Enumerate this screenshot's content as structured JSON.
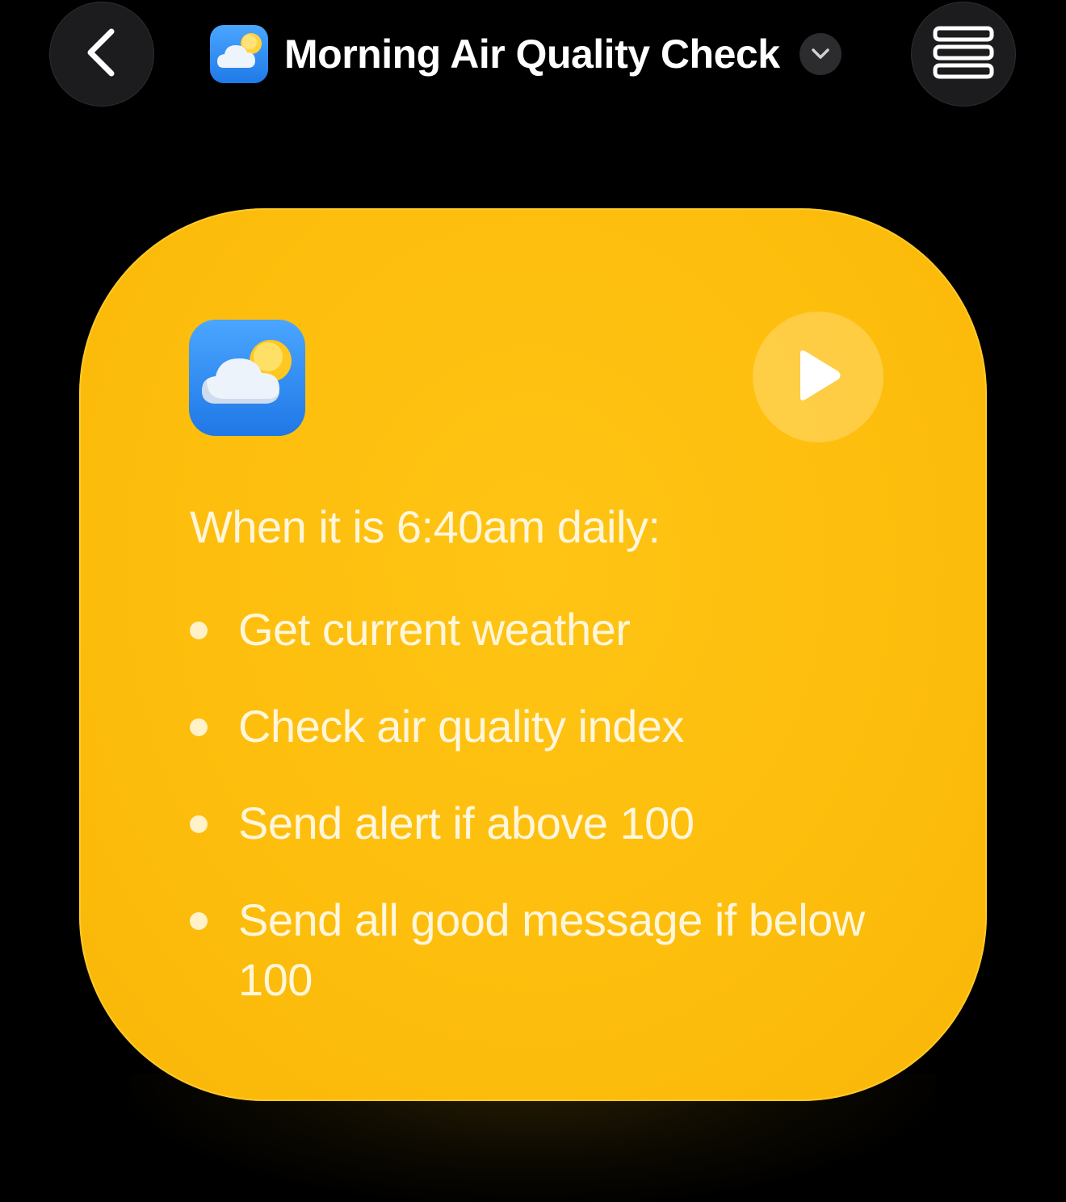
{
  "header": {
    "title": "Morning Air Quality Check",
    "back_icon": "chevron-left-icon",
    "menu_icon": "list-icon",
    "dropdown_icon": "chevron-down-icon"
  },
  "card": {
    "app_icon": "weather-icon",
    "play_icon": "play-icon",
    "trigger": "When it is 6:40am daily:",
    "steps": [
      "Get current weather",
      "Check air quality index",
      "Send alert if above 100",
      "Send all good message if below 100"
    ],
    "background_color": "#fdbd0c"
  }
}
